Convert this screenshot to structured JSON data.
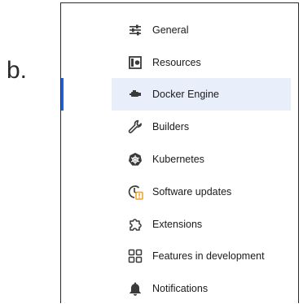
{
  "step_label": "b.",
  "menu": {
    "items": [
      {
        "label": "General",
        "icon": "sliders-icon",
        "active": false
      },
      {
        "label": "Resources",
        "icon": "resources-icon",
        "active": false
      },
      {
        "label": "Docker Engine",
        "icon": "docker-engine-icon",
        "active": true
      },
      {
        "label": "Builders",
        "icon": "wrench-icon",
        "active": false
      },
      {
        "label": "Kubernetes",
        "icon": "kubernetes-icon",
        "active": false
      },
      {
        "label": "Software updates",
        "icon": "update-clock-icon",
        "active": false
      },
      {
        "label": "Extensions",
        "icon": "puzzle-icon",
        "active": false
      },
      {
        "label": "Features in development",
        "icon": "grid-icon",
        "active": false
      },
      {
        "label": "Notifications",
        "icon": "bell-icon",
        "active": false
      }
    ]
  },
  "colors": {
    "active_bar": "#1f5fe8",
    "active_bg": "#e9eefb",
    "arrow": "#d61f1f",
    "update_badge": "#f0a020"
  }
}
